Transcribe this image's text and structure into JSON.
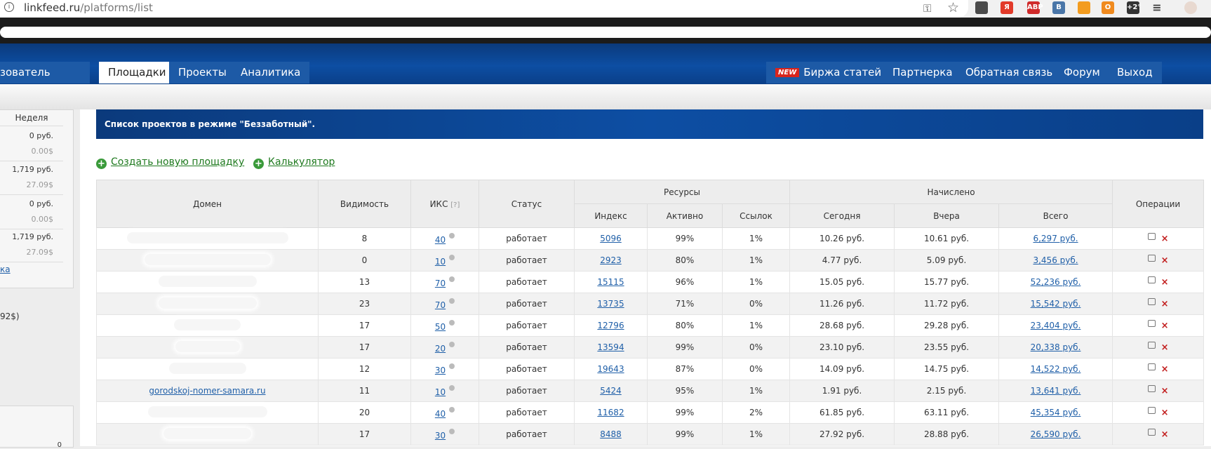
{
  "browser": {
    "url_host": "linkfeed.ru",
    "url_path": "/platforms/list",
    "extensions": [
      {
        "name": "ext-note-icon",
        "color": "#4a4a4a",
        "label": ""
      },
      {
        "name": "ext-yandex-icon",
        "color": "#e23b2a",
        "label": "Я"
      },
      {
        "name": "ext-adblock-icon",
        "color": "#d02b2b",
        "label": "ABP"
      },
      {
        "name": "ext-vk-icon",
        "color": "#4a76a8",
        "label": "B"
      },
      {
        "name": "ext-rss-icon",
        "color": "#f39c1f",
        "label": ""
      },
      {
        "name": "ext-ok-icon",
        "color": "#f08a1e",
        "label": "О"
      },
      {
        "name": "ext-weather-icon",
        "color": "#333333",
        "label": "+2°"
      }
    ]
  },
  "nav": {
    "left_tabs": [
      {
        "label": "зователь",
        "active": false
      },
      {
        "label": "Площадки",
        "active": true
      },
      {
        "label": "Проекты",
        "active": false
      },
      {
        "label": "Аналитика",
        "active": false
      }
    ],
    "right_tabs": [
      {
        "label": "Биржа статей",
        "badge": "NEW"
      },
      {
        "label": "Партнерка"
      },
      {
        "label": "Обратная связь"
      },
      {
        "label": "Форум"
      },
      {
        "label": "Выход"
      }
    ]
  },
  "sidebar": {
    "header": "Неделя",
    "cells": [
      {
        "rub": "0 руб.",
        "usd": "0.00$"
      },
      {
        "rub": "1,719 руб.",
        "usd": "27.09$"
      },
      {
        "rub": "0 руб.",
        "usd": "0.00$"
      },
      {
        "rub": "1,719 руб.",
        "usd": "27.09$"
      }
    ],
    "link": "ка",
    "extra": "92$)",
    "bottom_value": "0"
  },
  "main": {
    "title": "Список проектов в режиме \"Беззаботный\".",
    "actions": {
      "create": "Создать новую площадку",
      "calculator": "Калькулятор"
    }
  },
  "table": {
    "headers": {
      "domain": "Домен",
      "visibility": "Видимость",
      "iks": "ИКС",
      "iks_hint": "[?]",
      "status": "Статус",
      "resources": "Ресурсы",
      "accrued": "Начислено",
      "operations": "Операции",
      "index": "Индекс",
      "active": "Активно",
      "links": "Ссылок",
      "today": "Сегодня",
      "yesterday": "Вчера",
      "total": "Всего"
    },
    "rows": [
      {
        "domain": "",
        "visibility": "8",
        "iks": "40",
        "status": "работает",
        "index": "5096",
        "active": "99%",
        "links": "1%",
        "today": "10.26 руб.",
        "yesterday": "10.61 руб.",
        "total": "6,297 руб."
      },
      {
        "domain": "",
        "visibility": "0",
        "iks": "10",
        "status": "работает",
        "index": "2923",
        "active": "80%",
        "links": "1%",
        "today": "4.77 руб.",
        "yesterday": "5.09 руб.",
        "total": "3,456 руб."
      },
      {
        "domain": "",
        "visibility": "13",
        "iks": "70",
        "status": "работает",
        "index": "15115",
        "active": "96%",
        "links": "1%",
        "today": "15.05 руб.",
        "yesterday": "15.77 руб.",
        "total": "52,236 руб."
      },
      {
        "domain": "",
        "visibility": "23",
        "iks": "70",
        "status": "работает",
        "index": "13735",
        "active": "71%",
        "links": "0%",
        "today": "11.26 руб.",
        "yesterday": "11.72 руб.",
        "total": "15,542 руб."
      },
      {
        "domain": "",
        "visibility": "17",
        "iks": "50",
        "status": "работает",
        "index": "12796",
        "active": "80%",
        "links": "1%",
        "today": "28.68 руб.",
        "yesterday": "29.28 руб.",
        "total": "23,404 руб."
      },
      {
        "domain": "",
        "visibility": "17",
        "iks": "20",
        "status": "работает",
        "index": "13594",
        "active": "99%",
        "links": "0%",
        "today": "23.10 руб.",
        "yesterday": "23.55 руб.",
        "total": "20,338 руб."
      },
      {
        "domain": "",
        "visibility": "12",
        "iks": "30",
        "status": "работает",
        "index": "19643",
        "active": "87%",
        "links": "0%",
        "today": "14.09 руб.",
        "yesterday": "14.75 руб.",
        "total": "14,522 руб."
      },
      {
        "domain": "gorodskoj-nomer-samara.ru",
        "visibility": "11",
        "iks": "10",
        "status": "работает",
        "index": "5424",
        "active": "95%",
        "links": "1%",
        "today": "1.91 руб.",
        "yesterday": "2.15 руб.",
        "total": "13,641 руб."
      },
      {
        "domain": "",
        "visibility": "20",
        "iks": "40",
        "status": "работает",
        "index": "11682",
        "active": "99%",
        "links": "2%",
        "today": "61.85 руб.",
        "yesterday": "63.11 руб.",
        "total": "45,354 руб."
      },
      {
        "domain": "",
        "visibility": "17",
        "iks": "30",
        "status": "работает",
        "index": "8488",
        "active": "99%",
        "links": "1%",
        "today": "27.92 руб.",
        "yesterday": "28.88 руб.",
        "total": "26,590 руб."
      }
    ]
  }
}
